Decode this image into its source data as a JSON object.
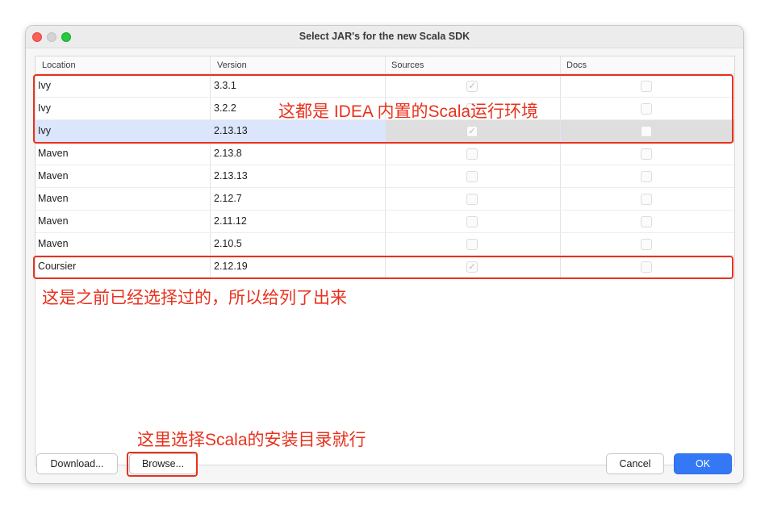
{
  "window": {
    "title": "Select JAR's for the new Scala SDK"
  },
  "table": {
    "columns": [
      "Location",
      "Version",
      "Sources",
      "Docs"
    ],
    "rows": [
      {
        "location": "Ivy",
        "version": "3.3.1",
        "sources": true,
        "docs": false
      },
      {
        "location": "Ivy",
        "version": "3.2.2",
        "sources": false,
        "docs": false
      },
      {
        "location": "Ivy",
        "version": "2.13.13",
        "sources": true,
        "docs": false,
        "selected": true
      },
      {
        "location": "Maven",
        "version": "2.13.8",
        "sources": false,
        "docs": false
      },
      {
        "location": "Maven",
        "version": "2.13.13",
        "sources": false,
        "docs": false
      },
      {
        "location": "Maven",
        "version": "2.12.7",
        "sources": false,
        "docs": false
      },
      {
        "location": "Maven",
        "version": "2.11.12",
        "sources": false,
        "docs": false
      },
      {
        "location": "Maven",
        "version": "2.10.5",
        "sources": false,
        "docs": false
      },
      {
        "location": "Coursier",
        "version": "2.12.19",
        "sources": true,
        "docs": false
      }
    ]
  },
  "buttons": {
    "download": "Download...",
    "browse": "Browse...",
    "cancel": "Cancel",
    "ok": "OK"
  },
  "annotations": {
    "idea_builtin": "这都是 IDEA 内置的Scala运行环境",
    "previously_selected": "这是之前已经选择过的，所以给列了出来",
    "browse_hint": "这里选择Scala的安装目录就行"
  },
  "colors": {
    "annotation": "#e8321e",
    "primary": "#3478f6",
    "selection": "#dbe5fb"
  }
}
